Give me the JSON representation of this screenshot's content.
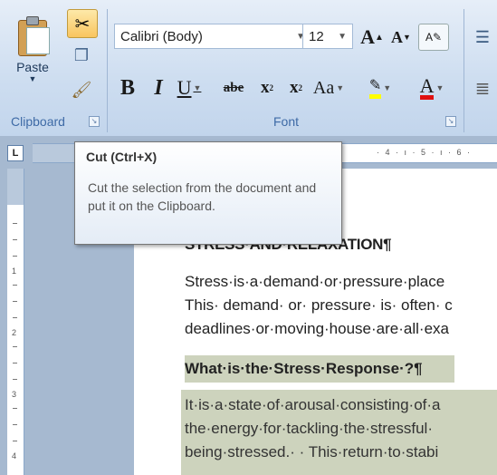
{
  "ribbon": {
    "clipboard": {
      "paste_label": "Paste",
      "group_label": "Clipboard",
      "cut_icon": "scissors-icon",
      "copy_icon": "copy-icon",
      "format_painter_icon": "format-painter-icon"
    },
    "font": {
      "group_label": "Font",
      "font_name": "Calibri (Body)",
      "font_size": "12",
      "grow": "A",
      "shrink": "A",
      "bold": "B",
      "italic": "I",
      "underline": "U",
      "strikethrough": "abe",
      "subscript": "x",
      "superscript": "x",
      "change_case": "Aa",
      "font_color": "A"
    }
  },
  "ruler": {
    "horizontal_marks": "· 4 · ı · 5 · ı · 6 ·",
    "vertical_numbers": [
      "1",
      "2",
      "3",
      "4"
    ]
  },
  "tooltip": {
    "title": "Cut (Ctrl+X)",
    "body": "Cut the selection from the document and put it on the Clipboard."
  },
  "document": {
    "heading": "STRESS·AND·RELAXATION¶",
    "para1_lines": [
      "Stress·is·a·demand·or·pressure·place",
      "This· demand· or· pressure· is· often· c",
      "deadlines·or·moving·house·are·all·exa"
    ],
    "subheading": "What·is·the·Stress·Response·?¶",
    "para2_lines": [
      "It·is·a·state·of·arousal·consisting·of·a",
      "the·energy·for·tackling·the·stressful·",
      "being·stressed.· · This·return·to·stabi"
    ]
  },
  "colors": {
    "highlight": "#ffff00",
    "font_color": "#e01010",
    "ribbon_label": "#3e6aa6",
    "selection_bg": "#cdd3bd"
  }
}
